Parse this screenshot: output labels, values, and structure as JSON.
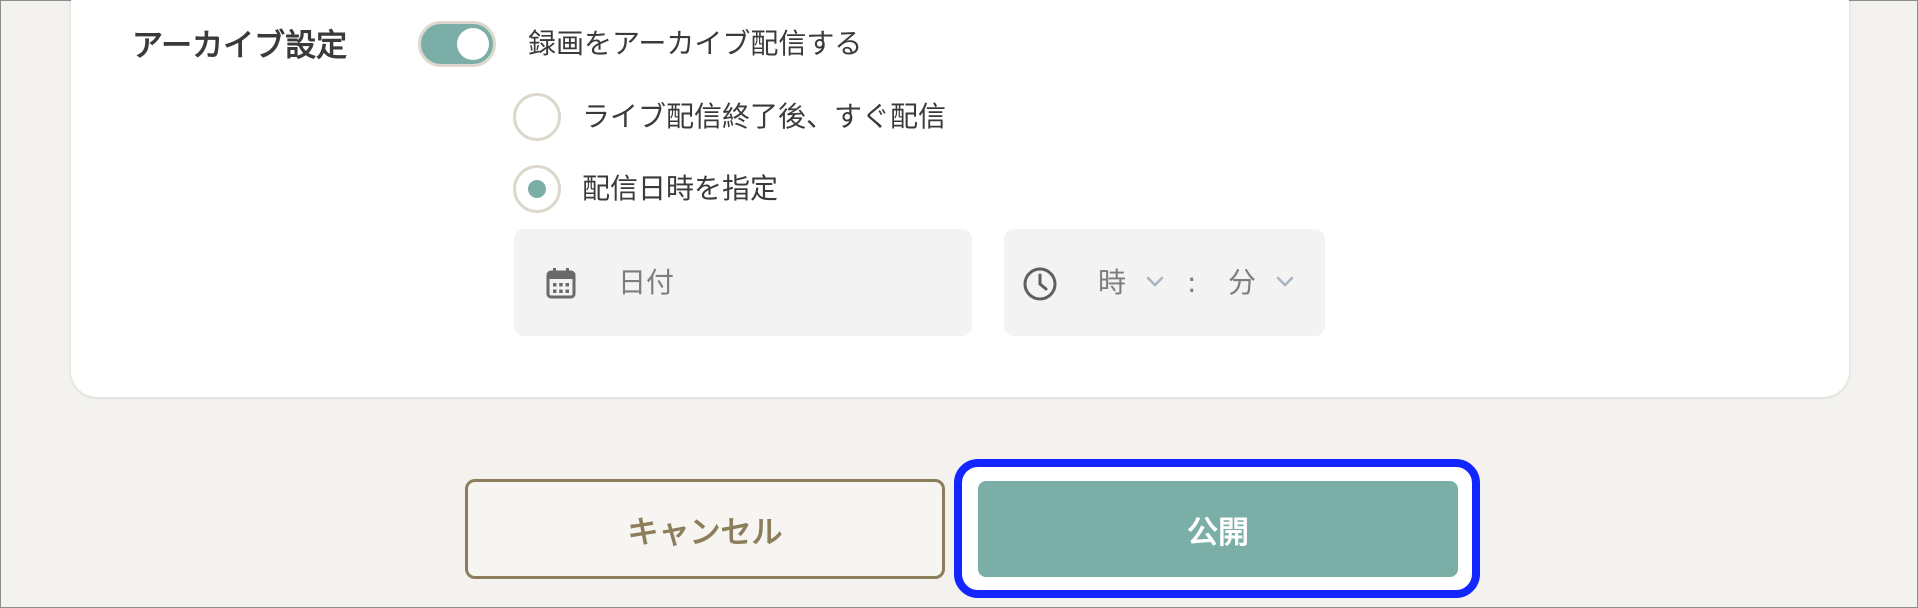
{
  "archive": {
    "section_label": "アーカイブ設定",
    "toggle_label": "録画をアーカイブ配信する",
    "toggle_on": true,
    "options": [
      {
        "label": "ライブ配信終了後、すぐ配信",
        "selected": false
      },
      {
        "label": "配信日時を指定",
        "selected": true
      }
    ],
    "date_placeholder": "日付",
    "hour_placeholder": "時",
    "time_separator": ":",
    "minute_placeholder": "分"
  },
  "actions": {
    "cancel_label": "キャンセル",
    "publish_label": "公開"
  },
  "colors": {
    "accent": "#7aaea7",
    "cancel_border": "#8c7e5b",
    "focus_outline": "#1326ff",
    "background": "#f3f2ee"
  },
  "icons": [
    "calendar-icon",
    "clock-icon",
    "chevron-down-icon"
  ]
}
